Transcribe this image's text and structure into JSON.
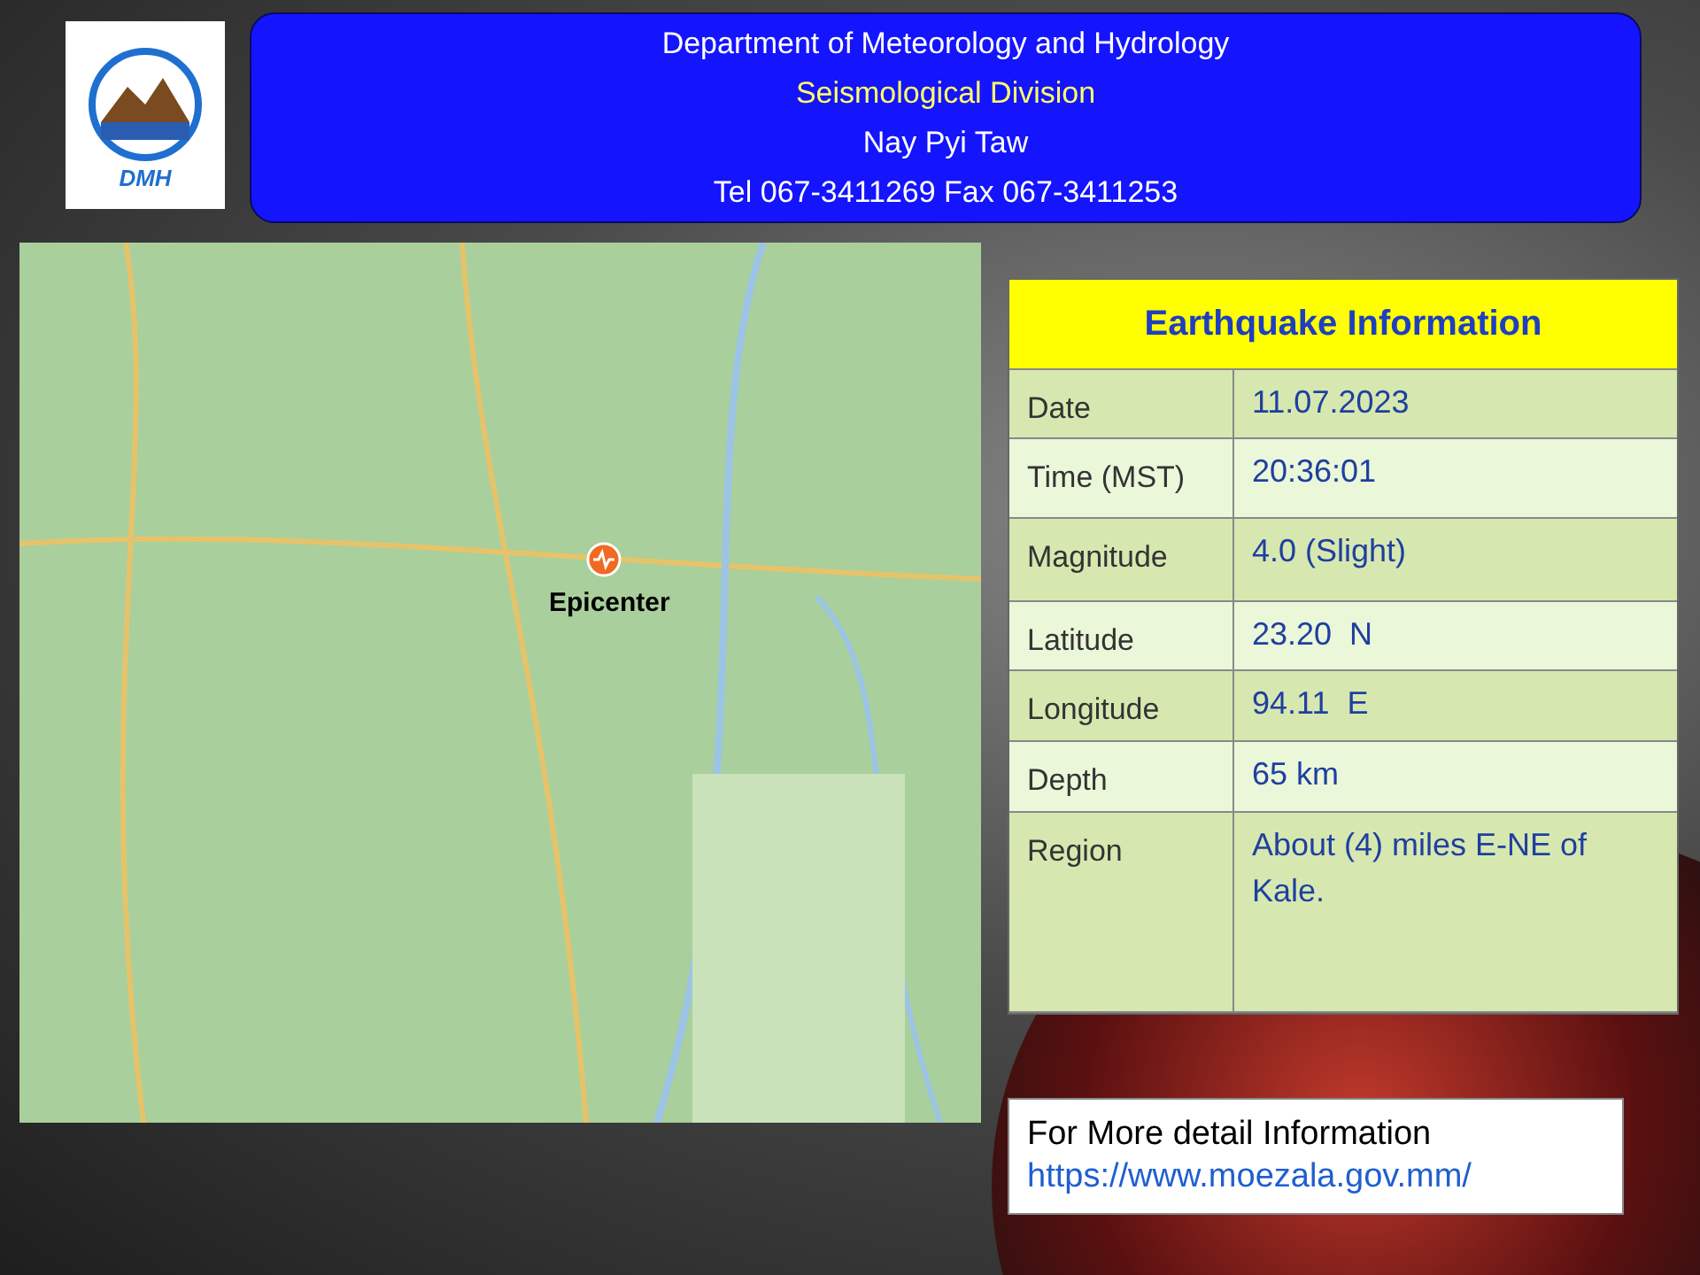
{
  "logo": {
    "text": "DMH"
  },
  "header": {
    "lines": [
      {
        "text": "Department of Meteorology and Hydrology",
        "kind": "plain"
      },
      {
        "text": "Seismological Division",
        "kind": "accent"
      },
      {
        "text": "Nay Pyi Taw",
        "kind": "plain"
      },
      {
        "text": "Tel 067-3411269 Fax 067-3411253",
        "kind": "plain"
      }
    ]
  },
  "map": {
    "marker_label": "Epicenter"
  },
  "info_table": {
    "title": "Earthquake Information",
    "rows": [
      {
        "label": "Date",
        "value": "11.07.2023"
      },
      {
        "label": "Time (MST)",
        "value": "20:36:01"
      },
      {
        "label": "Magnitude",
        "value": "4.0 (Slight)"
      },
      {
        "label": "Latitude",
        "value": "23.20  N"
      },
      {
        "label": "Longitude",
        "value": "94.11  E"
      },
      {
        "label": "Depth",
        "value": "65 km"
      },
      {
        "label": "Region",
        "value": "About (4) miles E-NE of Kale."
      }
    ]
  },
  "more_info": {
    "text": "For More detail Information",
    "link": "https://www.moezala.gov.mm/"
  }
}
